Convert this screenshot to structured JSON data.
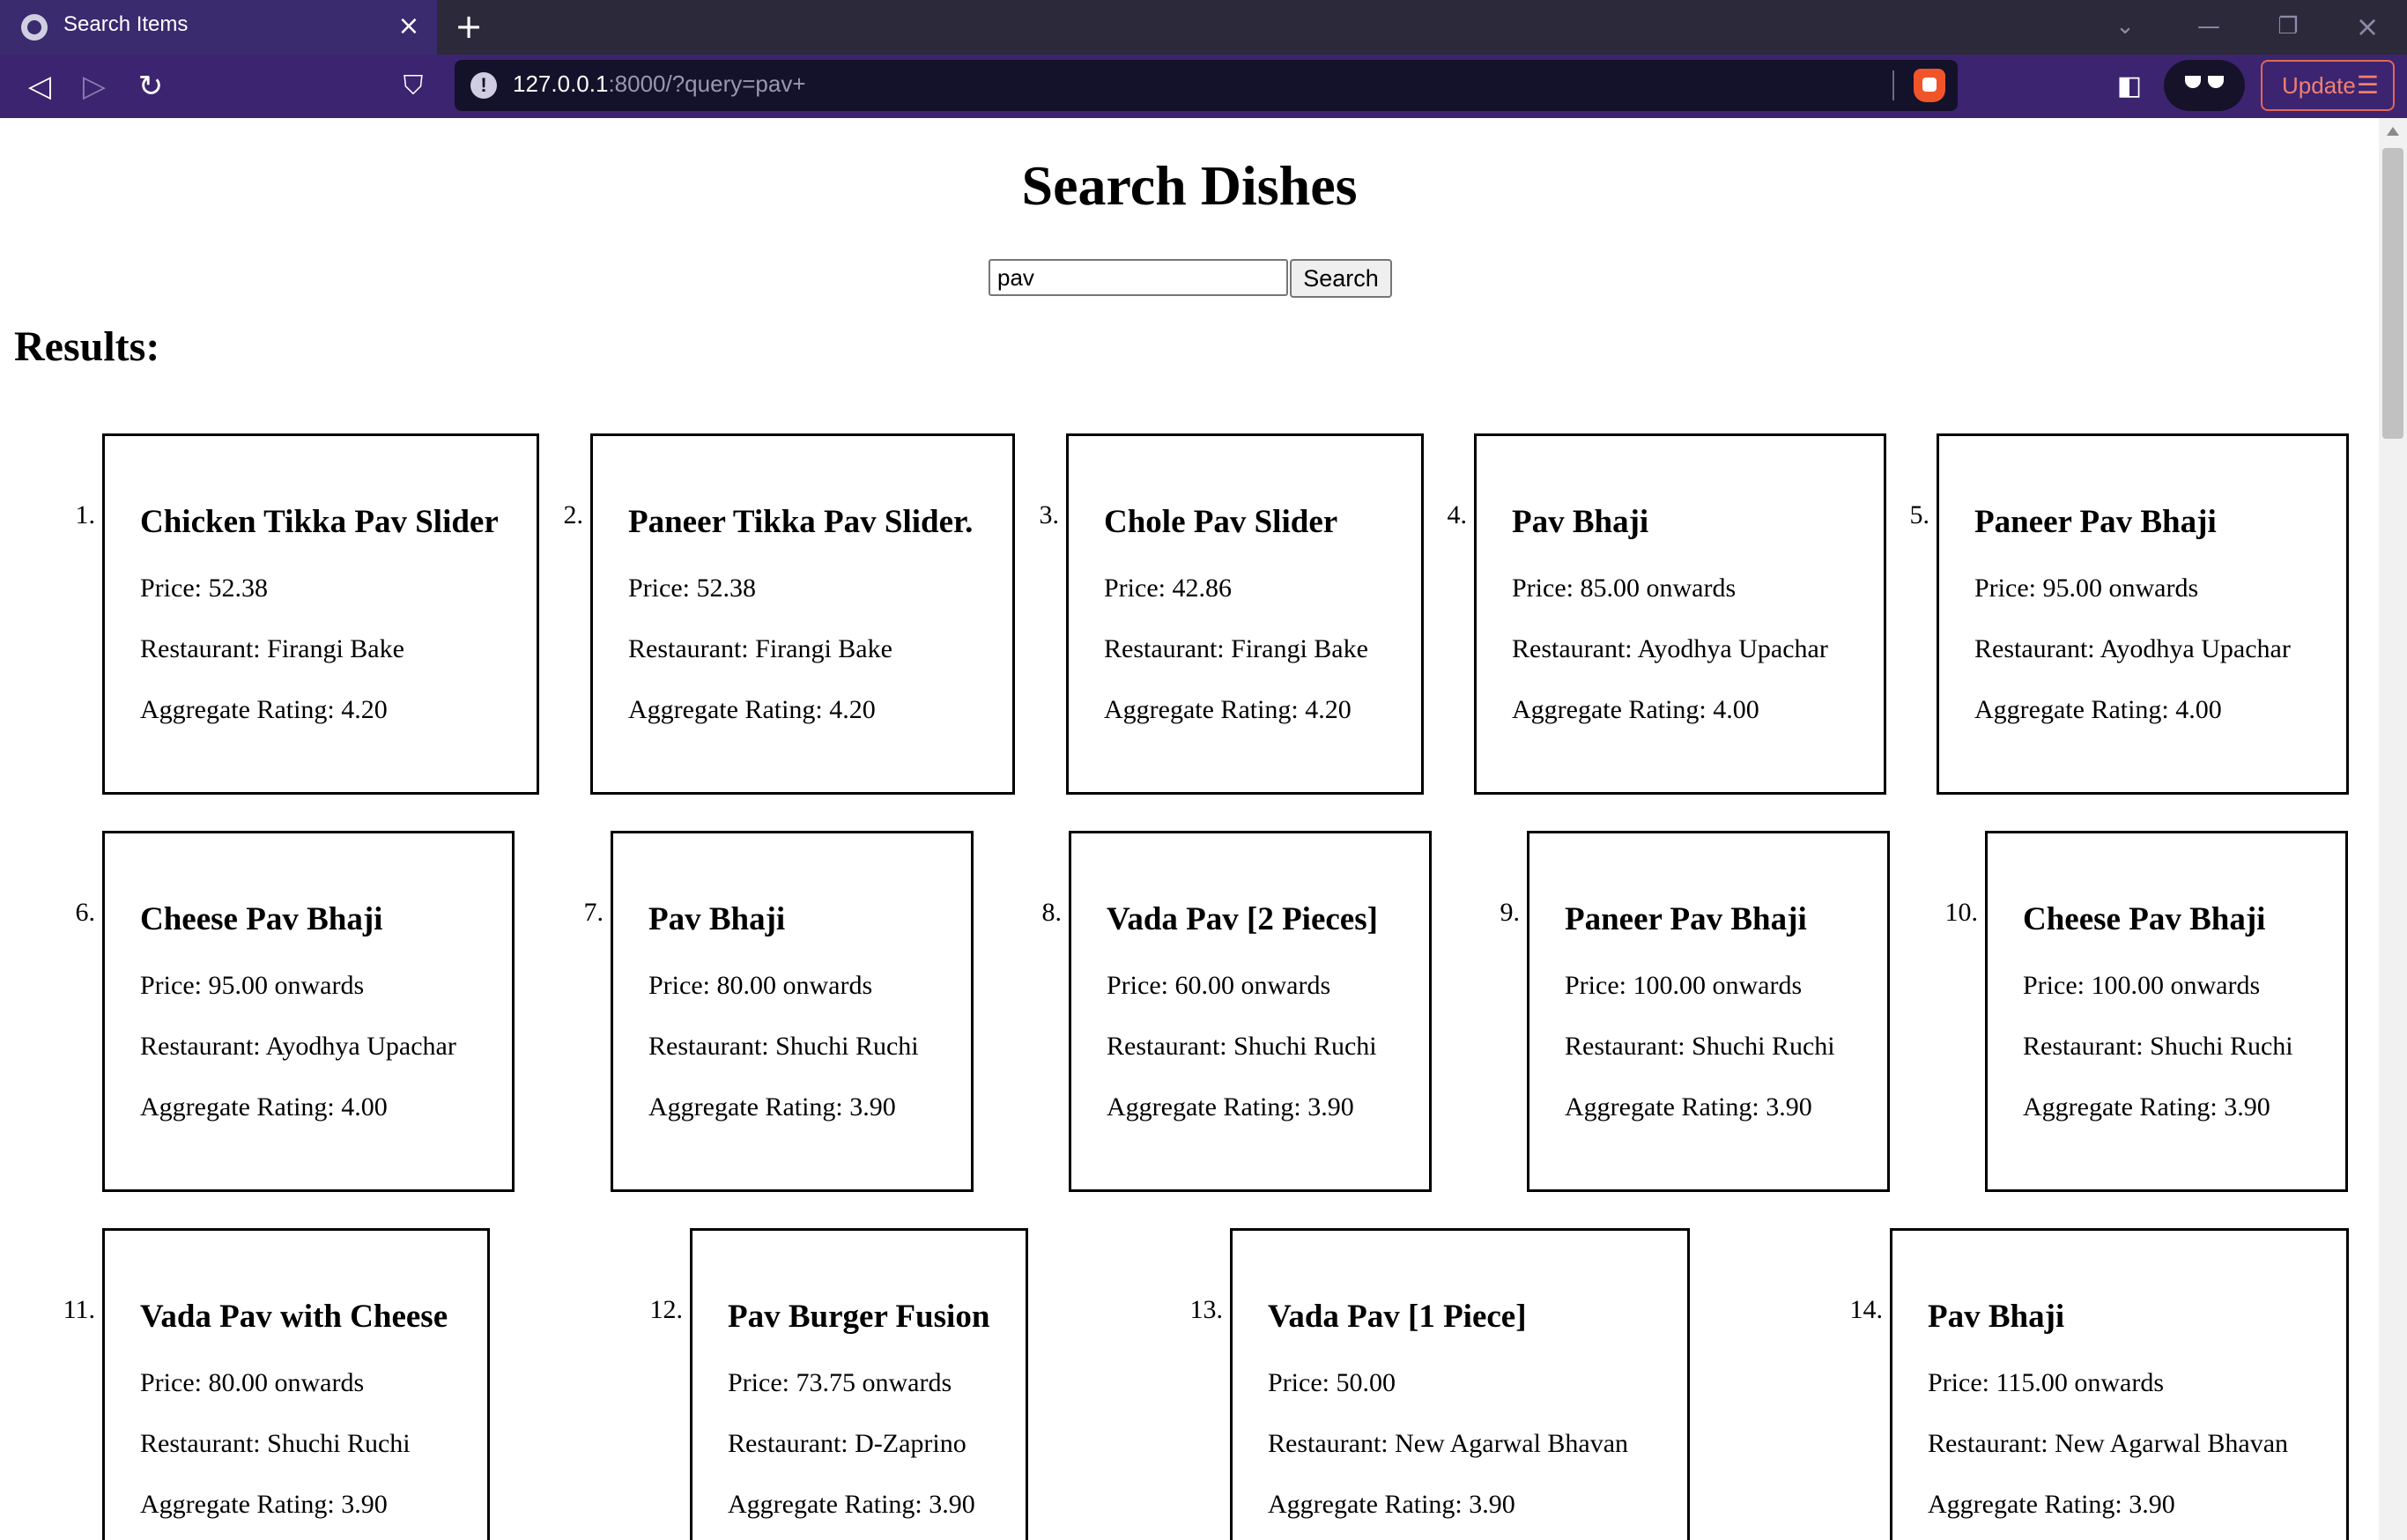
{
  "browser": {
    "tab_title": "Search Items",
    "url_host": "127.0.0.1",
    "url_rest": ":8000/?query=pav+",
    "update_label": "Update"
  },
  "page": {
    "heading": "Search Dishes",
    "search_value": "pav",
    "search_button": "Search",
    "results_heading": "Results:"
  },
  "labels": {
    "price": "Price: ",
    "restaurant": "Restaurant: ",
    "rating": "Aggregate Rating: "
  },
  "results": [
    {
      "num": "1.",
      "name": "Chicken Tikka Pav Slider",
      "price": "52.38",
      "restaurant": "Firangi Bake",
      "rating": "4.20"
    },
    {
      "num": "2.",
      "name": "Paneer Tikka Pav Slider.",
      "price": "52.38",
      "restaurant": "Firangi Bake",
      "rating": "4.20"
    },
    {
      "num": "3.",
      "name": "Chole Pav Slider",
      "price": "42.86",
      "restaurant": "Firangi Bake",
      "rating": "4.20"
    },
    {
      "num": "4.",
      "name": "Pav Bhaji",
      "price": "85.00 onwards",
      "restaurant": "Ayodhya Upachar",
      "rating": "4.00"
    },
    {
      "num": "5.",
      "name": "Paneer Pav Bhaji",
      "price": "95.00 onwards",
      "restaurant": "Ayodhya Upachar",
      "rating": "4.00"
    },
    {
      "num": "6.",
      "name": "Cheese Pav Bhaji",
      "price": "95.00 onwards",
      "restaurant": "Ayodhya Upachar",
      "rating": "4.00"
    },
    {
      "num": "7.",
      "name": "Pav Bhaji",
      "price": "80.00 onwards",
      "restaurant": "Shuchi Ruchi",
      "rating": "3.90"
    },
    {
      "num": "8.",
      "name": "Vada Pav [2 Pieces]",
      "price": "60.00 onwards",
      "restaurant": "Shuchi Ruchi",
      "rating": "3.90"
    },
    {
      "num": "9.",
      "name": "Paneer Pav Bhaji",
      "price": "100.00 onwards",
      "restaurant": "Shuchi Ruchi",
      "rating": "3.90"
    },
    {
      "num": "10.",
      "name": "Cheese Pav Bhaji",
      "price": "100.00 onwards",
      "restaurant": "Shuchi Ruchi",
      "rating": "3.90"
    },
    {
      "num": "11.",
      "name": "Vada Pav with Cheese",
      "price": "80.00 onwards",
      "restaurant": "Shuchi Ruchi",
      "rating": "3.90"
    },
    {
      "num": "12.",
      "name": "Pav Burger Fusion",
      "price": "73.75 onwards",
      "restaurant": "D-Zaprino",
      "rating": "3.90"
    },
    {
      "num": "13.",
      "name": "Vada Pav [1 Piece]",
      "price": "50.00",
      "restaurant": "New Agarwal Bhavan",
      "rating": "3.90"
    },
    {
      "num": "14.",
      "name": "Pav Bhaji",
      "price": "115.00 onwards",
      "restaurant": "New Agarwal Bhavan",
      "rating": "3.90"
    }
  ]
}
